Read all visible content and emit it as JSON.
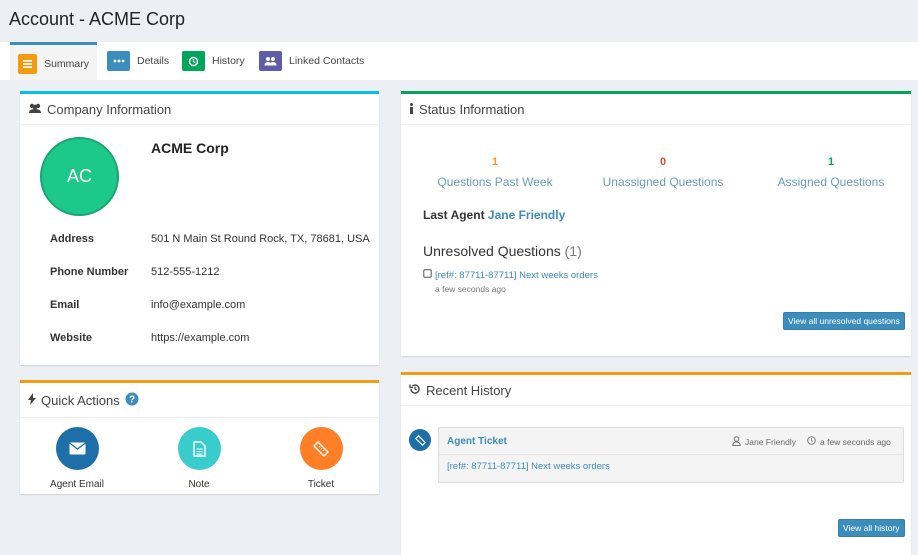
{
  "page": {
    "title": "Account - ACME Corp"
  },
  "tabs": [
    {
      "label": "Summary",
      "icon": "list-icon",
      "color": "#f39c12",
      "active": true
    },
    {
      "label": "Details",
      "icon": "ellipsis-icon",
      "color": "#3c8dbc"
    },
    {
      "label": "History",
      "icon": "history-icon",
      "color": "#00a65a"
    },
    {
      "label": "Linked Contacts",
      "icon": "users-icon",
      "color": "#605ca8"
    }
  ],
  "company": {
    "header": "Company Information",
    "initials": "AC",
    "name": "ACME Corp",
    "rows": [
      {
        "label": "Address",
        "value": "501 N Main St Round Rock, TX, 78681, USA"
      },
      {
        "label": "Phone Number",
        "value": "512-555-1212"
      },
      {
        "label": "Email",
        "value": "info@example.com"
      },
      {
        "label": "Website",
        "value": "https://example.com"
      }
    ]
  },
  "status": {
    "header": "Status Information",
    "stats": [
      {
        "value": "1",
        "label": "Questions Past Week",
        "color": "#f39c12"
      },
      {
        "value": "0",
        "label": "Unassigned Questions",
        "color": "#dd4b39"
      },
      {
        "value": "1",
        "label": "Assigned Questions",
        "color": "#00a65a"
      }
    ],
    "last_agent_label": "Last Agent",
    "last_agent_name": "Jane Friendly",
    "unresolved_title": "Unresolved Questions",
    "unresolved_count": "(1)",
    "unresolved_item": "[ref#: 87711-87711] Next weeks orders",
    "unresolved_time": "a few seconds ago",
    "view_all_label": "View all unresolved questions"
  },
  "quick_actions": {
    "header": "Quick Actions",
    "items": [
      {
        "label": "Agent Email",
        "icon": "envelope-icon",
        "color": "#1e6fa8"
      },
      {
        "label": "Note",
        "icon": "document-icon",
        "color": "#39cccc"
      },
      {
        "label": "Ticket",
        "icon": "ticket-icon",
        "color": "#ff7f26"
      }
    ]
  },
  "history": {
    "header": "Recent History",
    "entry": {
      "title": "Agent Ticket",
      "user": "Jane Friendly",
      "time": "a few seconds ago",
      "body": "[ref#: 87711-87711] Next weeks orders"
    },
    "view_all_label": "View all history"
  }
}
